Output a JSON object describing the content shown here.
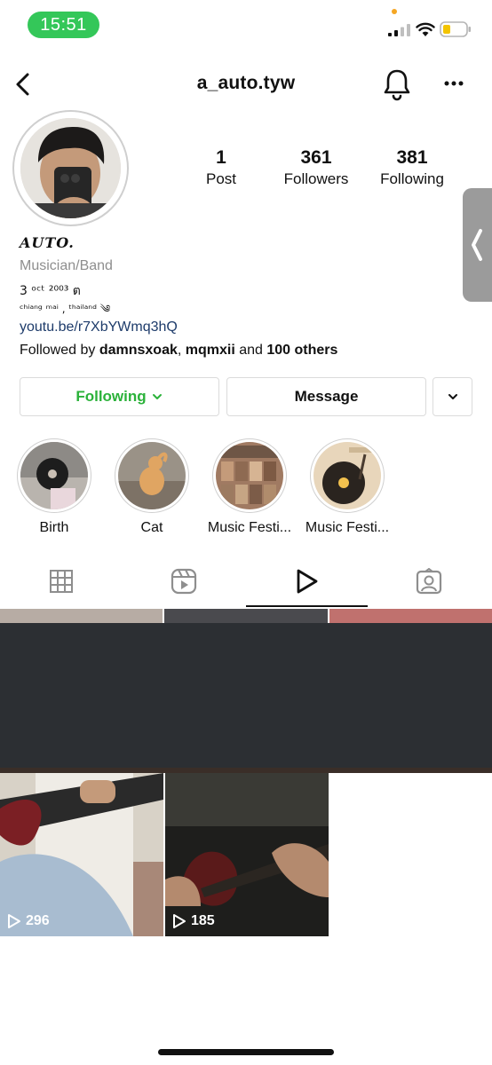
{
  "status_bar": {
    "time": "15:51",
    "accent_color": "#34c759",
    "icons": [
      "signal-icon",
      "wifi-icon",
      "battery-icon"
    ]
  },
  "nav": {
    "username": "a_auto.tyw",
    "icons": [
      "back-icon",
      "bell-icon",
      "more-icon"
    ]
  },
  "stats": [
    {
      "value": "1",
      "label": "Post"
    },
    {
      "value": "361",
      "label": "Followers"
    },
    {
      "value": "381",
      "label": "Following"
    }
  ],
  "bio": {
    "name": "AUTO.",
    "category": "Musician/Band",
    "line1": "3 ᵒᶜᵗ ²⁰⁰³ ต",
    "line2": "ᶜʰⁱᵃⁿᵍ ᵐᵃⁱ , ᵗʰᵃⁱˡᵃⁿᵈ ༄",
    "link": "youtu.be/r7XbYWmq3hQ",
    "followed_prefix": "Followed by ",
    "followed_user1": "damnsxoak",
    "followed_sep": ", ",
    "followed_user2": "mqmxii",
    "followed_mid": " and ",
    "followed_others": "100 others"
  },
  "buttons": {
    "following": "Following",
    "message": "Message",
    "following_color": "#2bb23a"
  },
  "highlights": [
    {
      "label": "Birth"
    },
    {
      "label": "Cat"
    },
    {
      "label": "Music Festi..."
    },
    {
      "label": "Music Festi..."
    }
  ],
  "tabs": [
    "grid-icon",
    "reels-icon",
    "play-icon",
    "tagged-icon"
  ],
  "grid": {
    "tiles": [
      {
        "views": "296"
      },
      {
        "views": "185"
      }
    ]
  }
}
